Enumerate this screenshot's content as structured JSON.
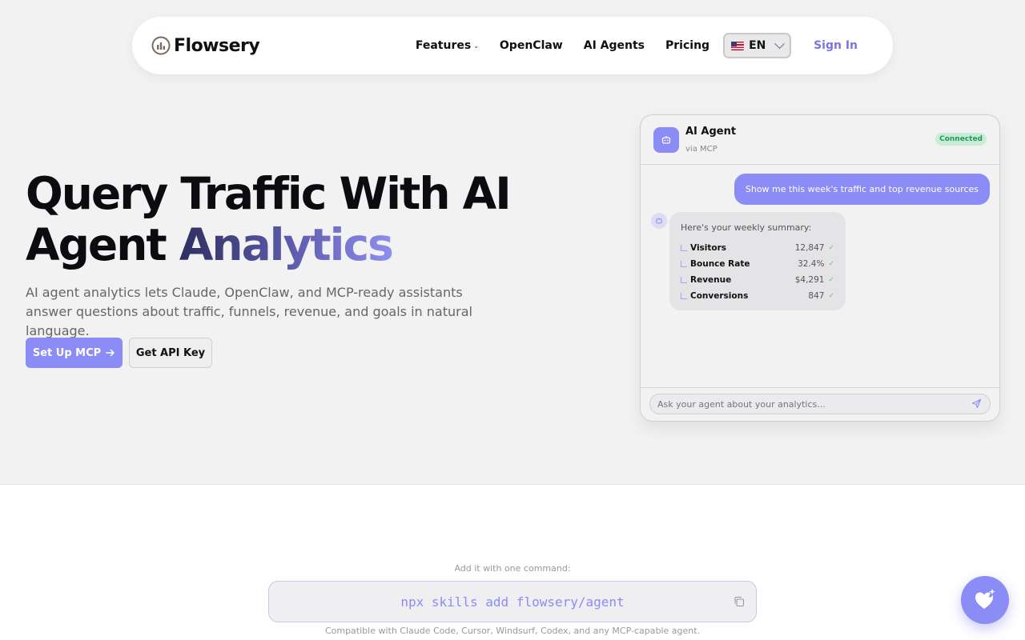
{
  "brand": {
    "name": "Flowsery",
    "accent": "#8b8cf6"
  },
  "nav": {
    "links": [
      {
        "label": "Features",
        "has_dropdown": true
      },
      {
        "label": "OpenClaw"
      },
      {
        "label": "AI Agents"
      },
      {
        "label": "Pricing"
      }
    ],
    "language": "EN",
    "sign_in": "Sign In"
  },
  "hero": {
    "title_line1": "Query Traffic With AI",
    "title_line2_plain": "Agent",
    "title_line2_accent": "Analytics",
    "subtitle": "AI agent analytics lets Claude, OpenClaw, and MCP-ready assistants answer questions about traffic, funnels, revenue, and goals in natural language.",
    "primary_button": "Set Up MCP",
    "secondary_button": "Get API Key"
  },
  "chat": {
    "agent_name": "AI Agent",
    "via": "via MCP",
    "status": "Connected",
    "user_message": "Show me this week's traffic and top revenue sources",
    "bot_intro": "Here's your weekly summary:",
    "stats": [
      {
        "label": "Visitors",
        "value": "12,847"
      },
      {
        "label": "Bounce Rate",
        "value": "32.4%"
      },
      {
        "label": "Revenue",
        "value": "$4,291"
      },
      {
        "label": "Conversions",
        "value": "847"
      }
    ],
    "input_placeholder": "Ask your agent about your analytics..."
  },
  "install": {
    "label": "Add it with one command:",
    "command": "npx skills add flowsery/agent",
    "compat": "Compatible with Claude Code, Cursor, Windsurf, Codex, and any MCP-capable agent."
  }
}
